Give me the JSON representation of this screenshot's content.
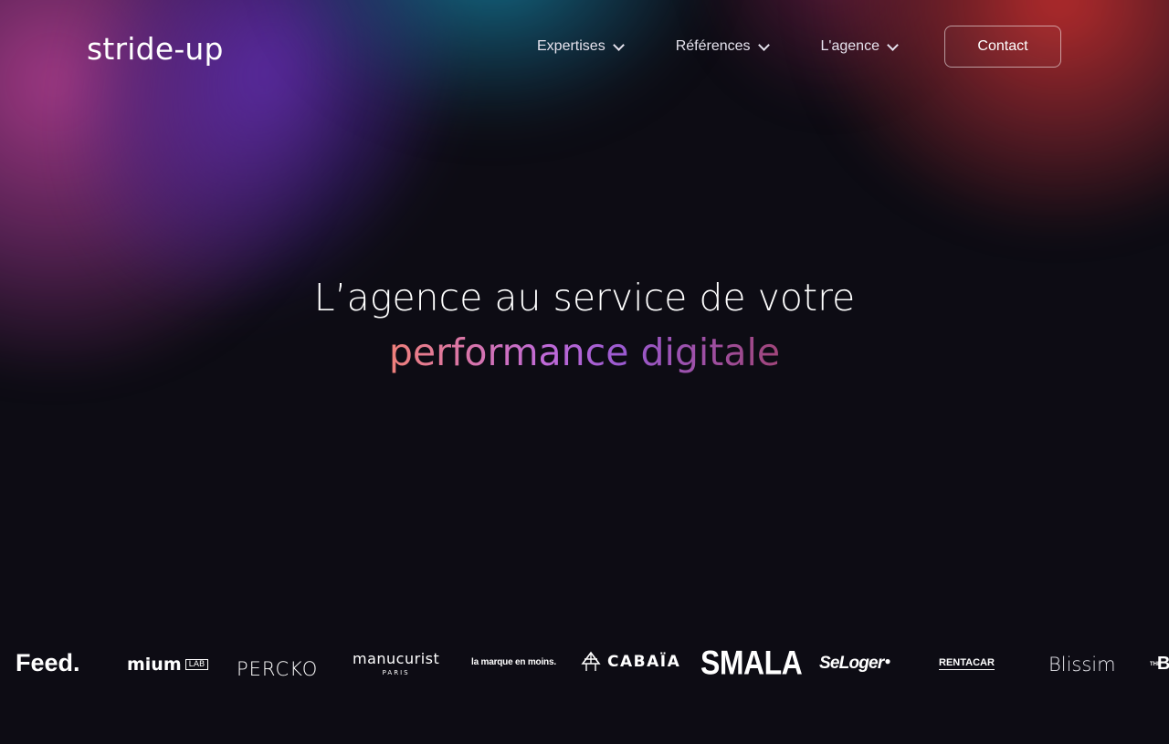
{
  "header": {
    "logo": "stride-up",
    "nav": [
      {
        "label": "Expertises"
      },
      {
        "label": "Références"
      },
      {
        "label": "L'agence"
      }
    ],
    "contact_label": "Contact"
  },
  "hero": {
    "line1": "L’agence au service de votre",
    "line2": "performance digitale"
  },
  "clients": {
    "feed": "Feed.",
    "mium": "mium",
    "mium_lab": "LAB",
    "percko": "PERCKO",
    "manucurist": "manucurist",
    "manucurist_sub": "PARIS",
    "lamarque": "la marque en moins.",
    "cabaia": "CABAÏA",
    "smala": "SMALA",
    "seloger": "SeLoger",
    "rentacar": "RENTACAR",
    "blissim": "Blissim",
    "cut_prefix": "THE",
    "cut": "B"
  },
  "colors": {
    "background": "#0d0c14",
    "gradient_start": "#f0807a",
    "gradient_mid": "#c06ad8",
    "gradient_end": "#a0457a"
  }
}
